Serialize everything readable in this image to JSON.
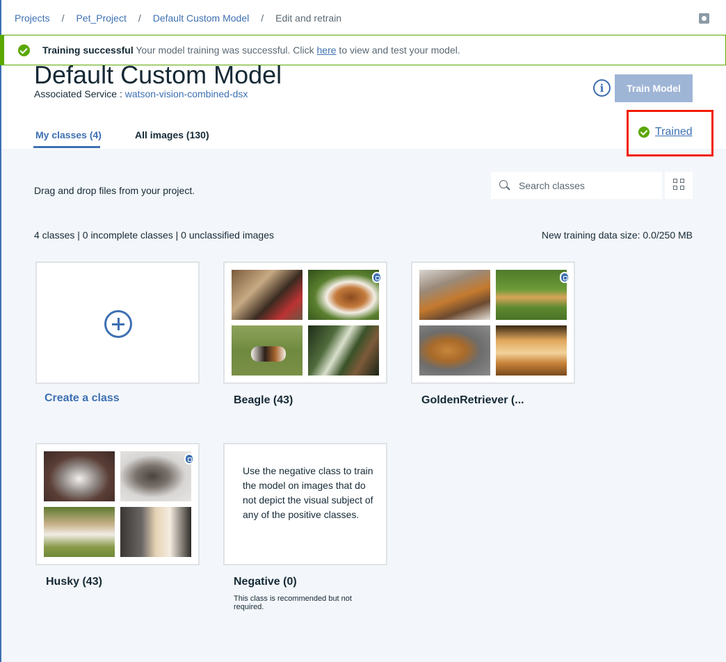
{
  "breadcrumb": [
    "Projects",
    "Pet_Project",
    "Default Custom Model",
    "Edit and retrain"
  ],
  "breadcrumb_separator": "/",
  "notification": {
    "title": "Training successful",
    "message_before": " Your model training was successful. Click ",
    "link": "here",
    "message_after": " to view and test your model.",
    "status_color": "#5aa700"
  },
  "model": {
    "title": "Default Custom Model",
    "service_label": "Associated Service : ",
    "service_name": "watson-vision-combined-dsx"
  },
  "train_button": "Train Model",
  "status": {
    "label": "Trained",
    "icon": "check-circle-icon"
  },
  "tabs": [
    {
      "label": "My classes (4)",
      "active": true
    },
    {
      "label": "All images (130)",
      "active": false
    }
  ],
  "drag_hint": "Drag and drop files from your project.",
  "search": {
    "placeholder": "Search classes"
  },
  "counts": "4 classes | 0 incomplete classes | 0 unclassified images",
  "data_size": "New training data size: 0.0/250 MB",
  "create_class": "Create a class",
  "classes": [
    {
      "title": "Beagle (43)"
    },
    {
      "title": "GoldenRetriever (..."
    },
    {
      "title": "Husky (43)"
    }
  ],
  "negative": {
    "title": "Negative (0)",
    "description": "Use the negative class to train the model on images that do not depict the visual subject of any of the positive classes.",
    "note": "This class is recommended but not required."
  },
  "colors": {
    "accent": "#3d70b2",
    "success": "#5aa700",
    "highlight": "#f21c00",
    "background": "#f3f6fa"
  }
}
